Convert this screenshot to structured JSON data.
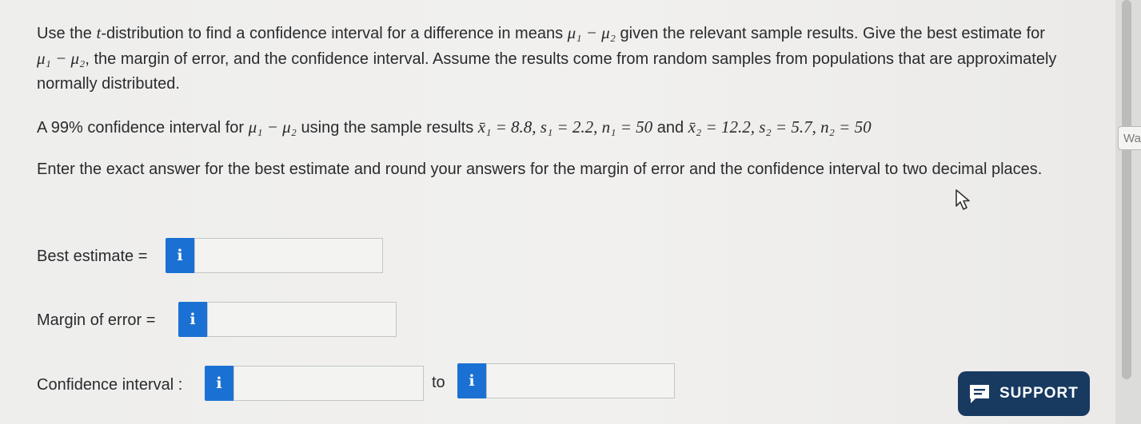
{
  "question": {
    "intro_1": "Use the ",
    "intro_t": "t",
    "intro_2": "-distribution to find a confidence interval for a difference in means ",
    "mu_diff": "μ₁ − μ₂",
    "intro_3": " given the relevant sample results. Give the best estimate for ",
    "intro_4": ", the margin of error, and the confidence interval. Assume the results come from random samples from populations that are approximately normally distributed.",
    "ci_prefix": "A 99% confidence interval for ",
    "ci_middle": " using the sample results ",
    "sample1": "x̄₁ = 8.8, s₁ = 2.2, n₁ = 50",
    "and_word": " and ",
    "sample2": "x̄₂ = 12.2, s₂ = 5.7, n₂ = 50",
    "instructions": "Enter the exact answer for the best estimate and round your answers for the margin of error and the confidence interval to two decimal places."
  },
  "fields": {
    "best_estimate_label": "Best estimate =",
    "best_estimate_value": "",
    "margin_label": "Margin of error =",
    "margin_value": "",
    "ci_label": "Confidence interval :",
    "ci_lower_value": "",
    "to_label": "to",
    "ci_upper_value": ""
  },
  "info_button": {
    "glyph": "i",
    "icon": "info-icon",
    "color": "#1b71d3"
  },
  "support": {
    "label": "SUPPORT",
    "icon": "chat-bubble-icon",
    "color": "#183a61"
  },
  "side_tab": {
    "label": "Wa"
  }
}
